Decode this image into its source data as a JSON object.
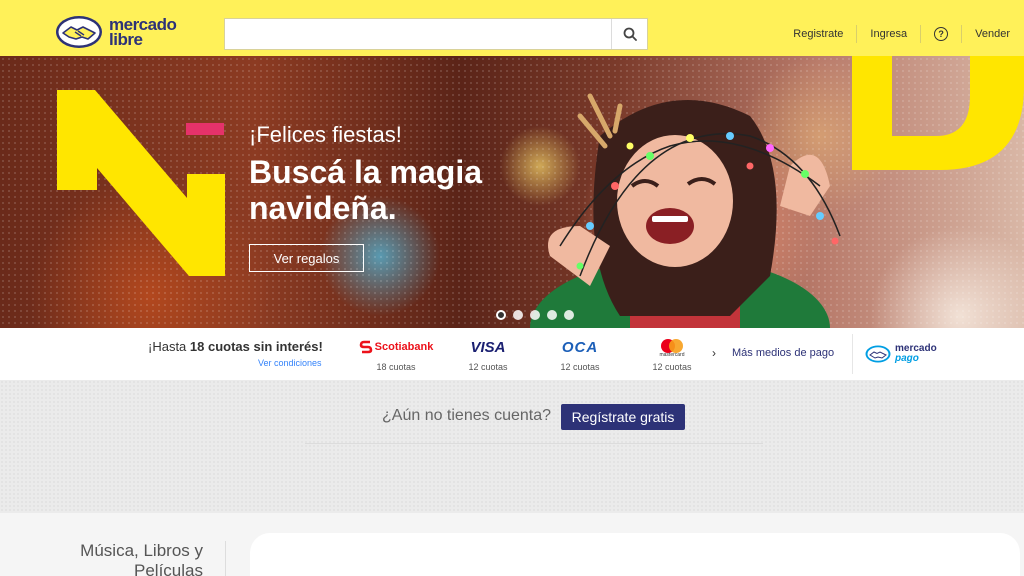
{
  "header": {
    "logo": {
      "line1": "mercado",
      "line2": "libre"
    },
    "search": {
      "value": "",
      "placeholder": ""
    },
    "nav": {
      "register": "Registrate",
      "login": "Ingresa",
      "help": "?",
      "sell": "Vender"
    }
  },
  "hero": {
    "subtitle": "¡Felices fiestas!",
    "title": "Buscá la magia navideña.",
    "button": "Ver regalos",
    "slides_total": 5,
    "slide_active": 1
  },
  "payments": {
    "headline_pre": "¡Hasta ",
    "headline_bold": "18 cuotas sin interés!",
    "conditions_link": "Ver condiciones",
    "cards": [
      {
        "name": "Scotiabank",
        "cuotas": "18 cuotas"
      },
      {
        "name": "VISA",
        "cuotas": "12 cuotas"
      },
      {
        "name": "OCA",
        "cuotas": "12 cuotas"
      },
      {
        "name": "mastercard",
        "cuotas": "12 cuotas"
      }
    ],
    "more_link": "Más medios de pago",
    "mp_logo": {
      "line1": "mercado",
      "line2": "pago"
    }
  },
  "register_band": {
    "question": "¿Aún no tienes cuenta?",
    "button": "Regístrate gratis"
  },
  "category": {
    "title": "Música, Libros y Películas"
  },
  "colors": {
    "header_bg": "#fff159",
    "brand_blue": "#2d3277",
    "link_blue": "#3483fa",
    "accent_pink": "#e5326a",
    "accent_yellow": "#ffe600"
  }
}
